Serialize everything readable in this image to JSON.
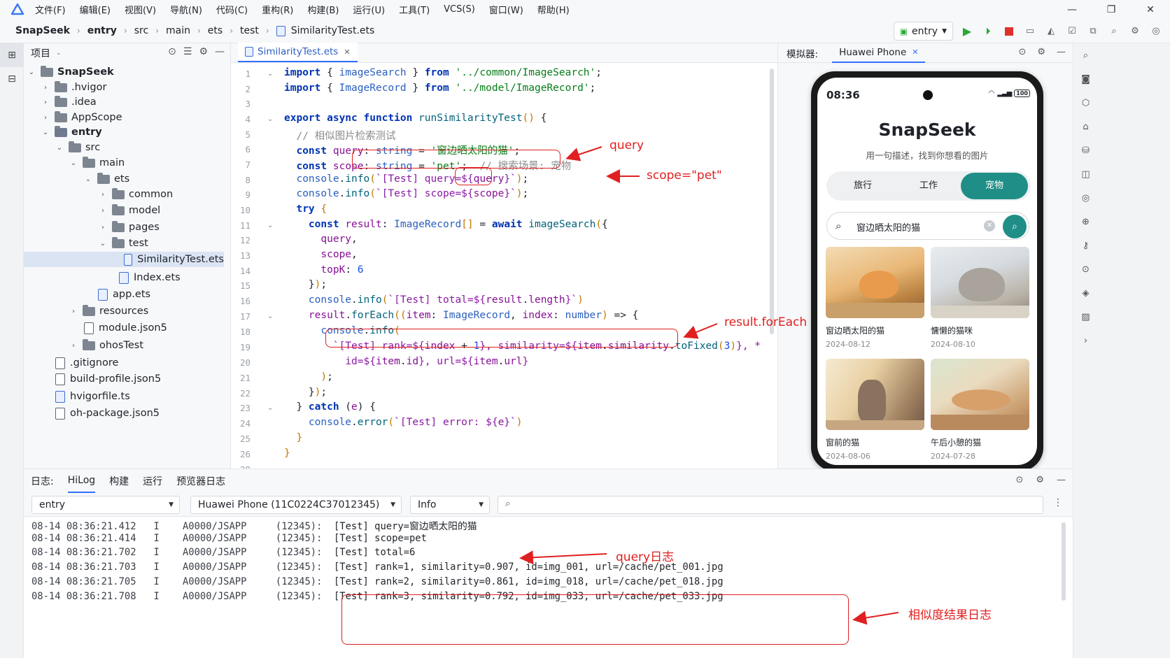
{
  "menubar": {
    "items": [
      "文件(F)",
      "编辑(E)",
      "视图(V)",
      "导航(N)",
      "代码(C)",
      "重构(R)",
      "构建(B)",
      "运行(U)",
      "工具(T)",
      "VCS(S)",
      "窗口(W)",
      "帮助(H)"
    ]
  },
  "breadcrumb": [
    "SnapSeek",
    "entry",
    "src",
    "main",
    "ets",
    "test",
    "SimilarityTest.ets"
  ],
  "run_config": "entry",
  "project": {
    "title": "项目",
    "tree": [
      {
        "label": "SnapSeek",
        "bold": true
      },
      {
        "label": ".hvigor"
      },
      {
        "label": ".idea"
      },
      {
        "label": "AppScope"
      },
      {
        "label": "entry",
        "bold": true
      },
      {
        "label": "src"
      },
      {
        "label": "main"
      },
      {
        "label": "ets"
      },
      {
        "label": "common"
      },
      {
        "label": "model"
      },
      {
        "label": "pages"
      },
      {
        "label": "test"
      },
      {
        "label": "SimilarityTest.ets"
      },
      {
        "label": "Index.ets"
      },
      {
        "label": "app.ets"
      },
      {
        "label": "resources"
      },
      {
        "label": "module.json5"
      },
      {
        "label": "ohosTest"
      },
      {
        "label": ".gitignore"
      },
      {
        "label": "build-profile.json5"
      },
      {
        "label": "hvigorfile.ts"
      },
      {
        "label": "oh-package.json5"
      }
    ]
  },
  "editor": {
    "tab": "SimilarityTest.ets",
    "line_numbers": [
      "1",
      "2",
      "3",
      "4",
      "5",
      "6",
      "7",
      "8",
      "9",
      "10",
      "11",
      "12",
      "13",
      "14",
      "15",
      "16",
      "17",
      "18",
      "19",
      "20",
      "21",
      "22",
      "23",
      "24",
      "25",
      "26",
      "28"
    ]
  },
  "simulator": {
    "label": "模拟器:",
    "device_tab": "Huawei Phone",
    "phone": {
      "time": "08:36",
      "battery": "100",
      "app_title": "SnapSeek",
      "subtitle": "用一句描述，找到你想看的图片",
      "segments": [
        "旅行",
        "工作",
        "宠物"
      ],
      "selected_segment": "宠物",
      "search_value": "窗边晒太阳的猫",
      "cards": [
        {
          "title": "窗边晒太阳的猫",
          "date": "2024-08-12"
        },
        {
          "title": "慵懒的猫咪",
          "date": "2024-08-10"
        },
        {
          "title": "窗前的猫",
          "date": "2024-08-06"
        },
        {
          "title": "午后小憩的猫",
          "date": "2024-07-28"
        }
      ]
    }
  },
  "log": {
    "label": "日志:",
    "tabs": [
      "HiLog",
      "构建",
      "运行",
      "预览器日志"
    ],
    "active_tab": "HiLog",
    "module_filter": "entry",
    "device_filter": "Huawei Phone (11C0224C37012345)",
    "level_filter": "Info",
    "lines": [
      {
        "time": "08-14 08:36:21.412",
        "level": "I",
        "tag": "A0000/JSAPP",
        "pid": "(12345):",
        "msg": "[Test] query=窗边晒太阳的猫"
      },
      {
        "time": "08-14 08:36:21.414",
        "level": "I",
        "tag": "A0000/JSAPP",
        "pid": "(12345):",
        "msg": "[Test] scope=pet"
      },
      {
        "time": "08-14 08:36:21.702",
        "level": "I",
        "tag": "A0000/JSAPP",
        "pid": "(12345):",
        "msg": "[Test] total=6"
      },
      {
        "time": "08-14 08:36:21.703",
        "level": "I",
        "tag": "A0000/JSAPP",
        "pid": "(12345):",
        "msg": "[Test] rank=1, similarity=0.907, id=img_001, url=/cache/pet_001.jpg"
      },
      {
        "time": "08-14 08:36:21.705",
        "level": "I",
        "tag": "A0000/JSAPP",
        "pid": "(12345):",
        "msg": "[Test] rank=2, similarity=0.861, id=img_018, url=/cache/pet_018.jpg"
      },
      {
        "time": "08-14 08:36:21.708",
        "level": "I",
        "tag": "A0000/JSAPP",
        "pid": "(12345):",
        "msg": "[Test] rank=3, similarity=0.792, id=img_033, url=/cache/pet_033.jpg"
      }
    ]
  },
  "annotations": {
    "query": "query",
    "scope": "scope=\"pet\"",
    "foreach": "result.forEach",
    "query_log": "query日志",
    "sim_log": "相似度结果日志"
  },
  "colors": {
    "accent": "#3370ff",
    "teal": "#1f8e86",
    "annotation": "#e02020",
    "run_green": "#2aa838",
    "stop_red": "#e0302a"
  }
}
